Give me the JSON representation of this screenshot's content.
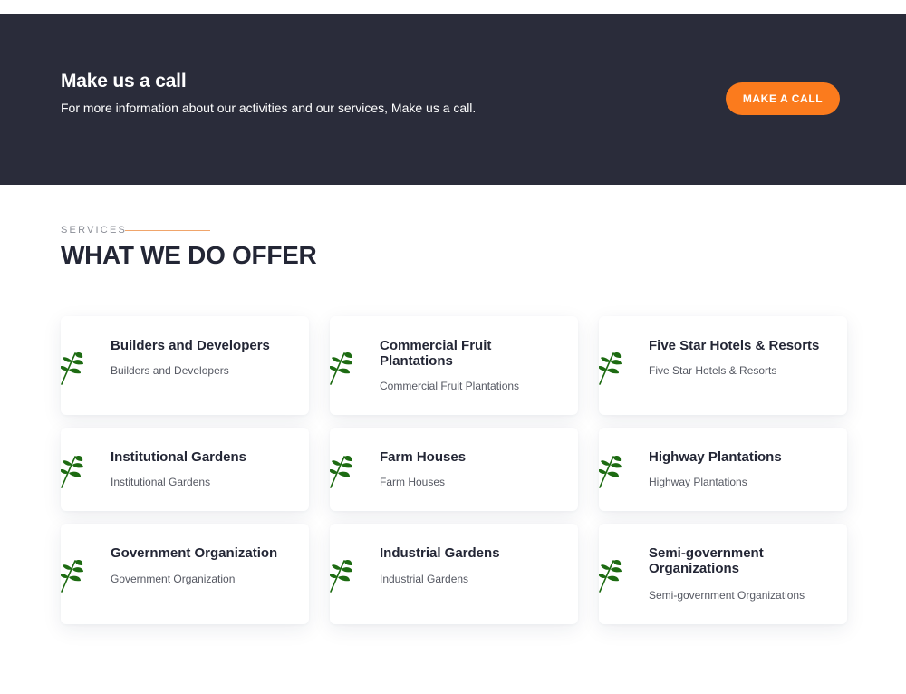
{
  "cta": {
    "title": "Make us a call",
    "text": "For more information about our activities and our services, Make us a call.",
    "button_label": "MAKE A CALL",
    "background_color": "#2a2c3a",
    "button_color": "#fb7b1d"
  },
  "services": {
    "eyebrow": "SERVICES",
    "heading": "WHAT WE DO OFFER",
    "icon": "leaf-sprig-icon",
    "icon_color": "#1d6b12",
    "items": [
      {
        "title": "Builders and Developers",
        "description": "Builders and Developers"
      },
      {
        "title": "Commercial Fruit Plantations",
        "description": "Commercial Fruit Plantations"
      },
      {
        "title": "Five Star Hotels & Resorts",
        "description": "Five Star Hotels & Resorts"
      },
      {
        "title": "Institutional Gardens",
        "description": "Institutional Gardens"
      },
      {
        "title": "Farm Houses",
        "description": "Farm Houses"
      },
      {
        "title": "Highway Plantations",
        "description": "Highway Plantations"
      },
      {
        "title": "Government Organization",
        "description": "Government Organization"
      },
      {
        "title": "Industrial Gardens",
        "description": "Industrial Gardens"
      },
      {
        "title": "Semi-government Organizations",
        "description": "Semi-government Organizations"
      }
    ]
  }
}
